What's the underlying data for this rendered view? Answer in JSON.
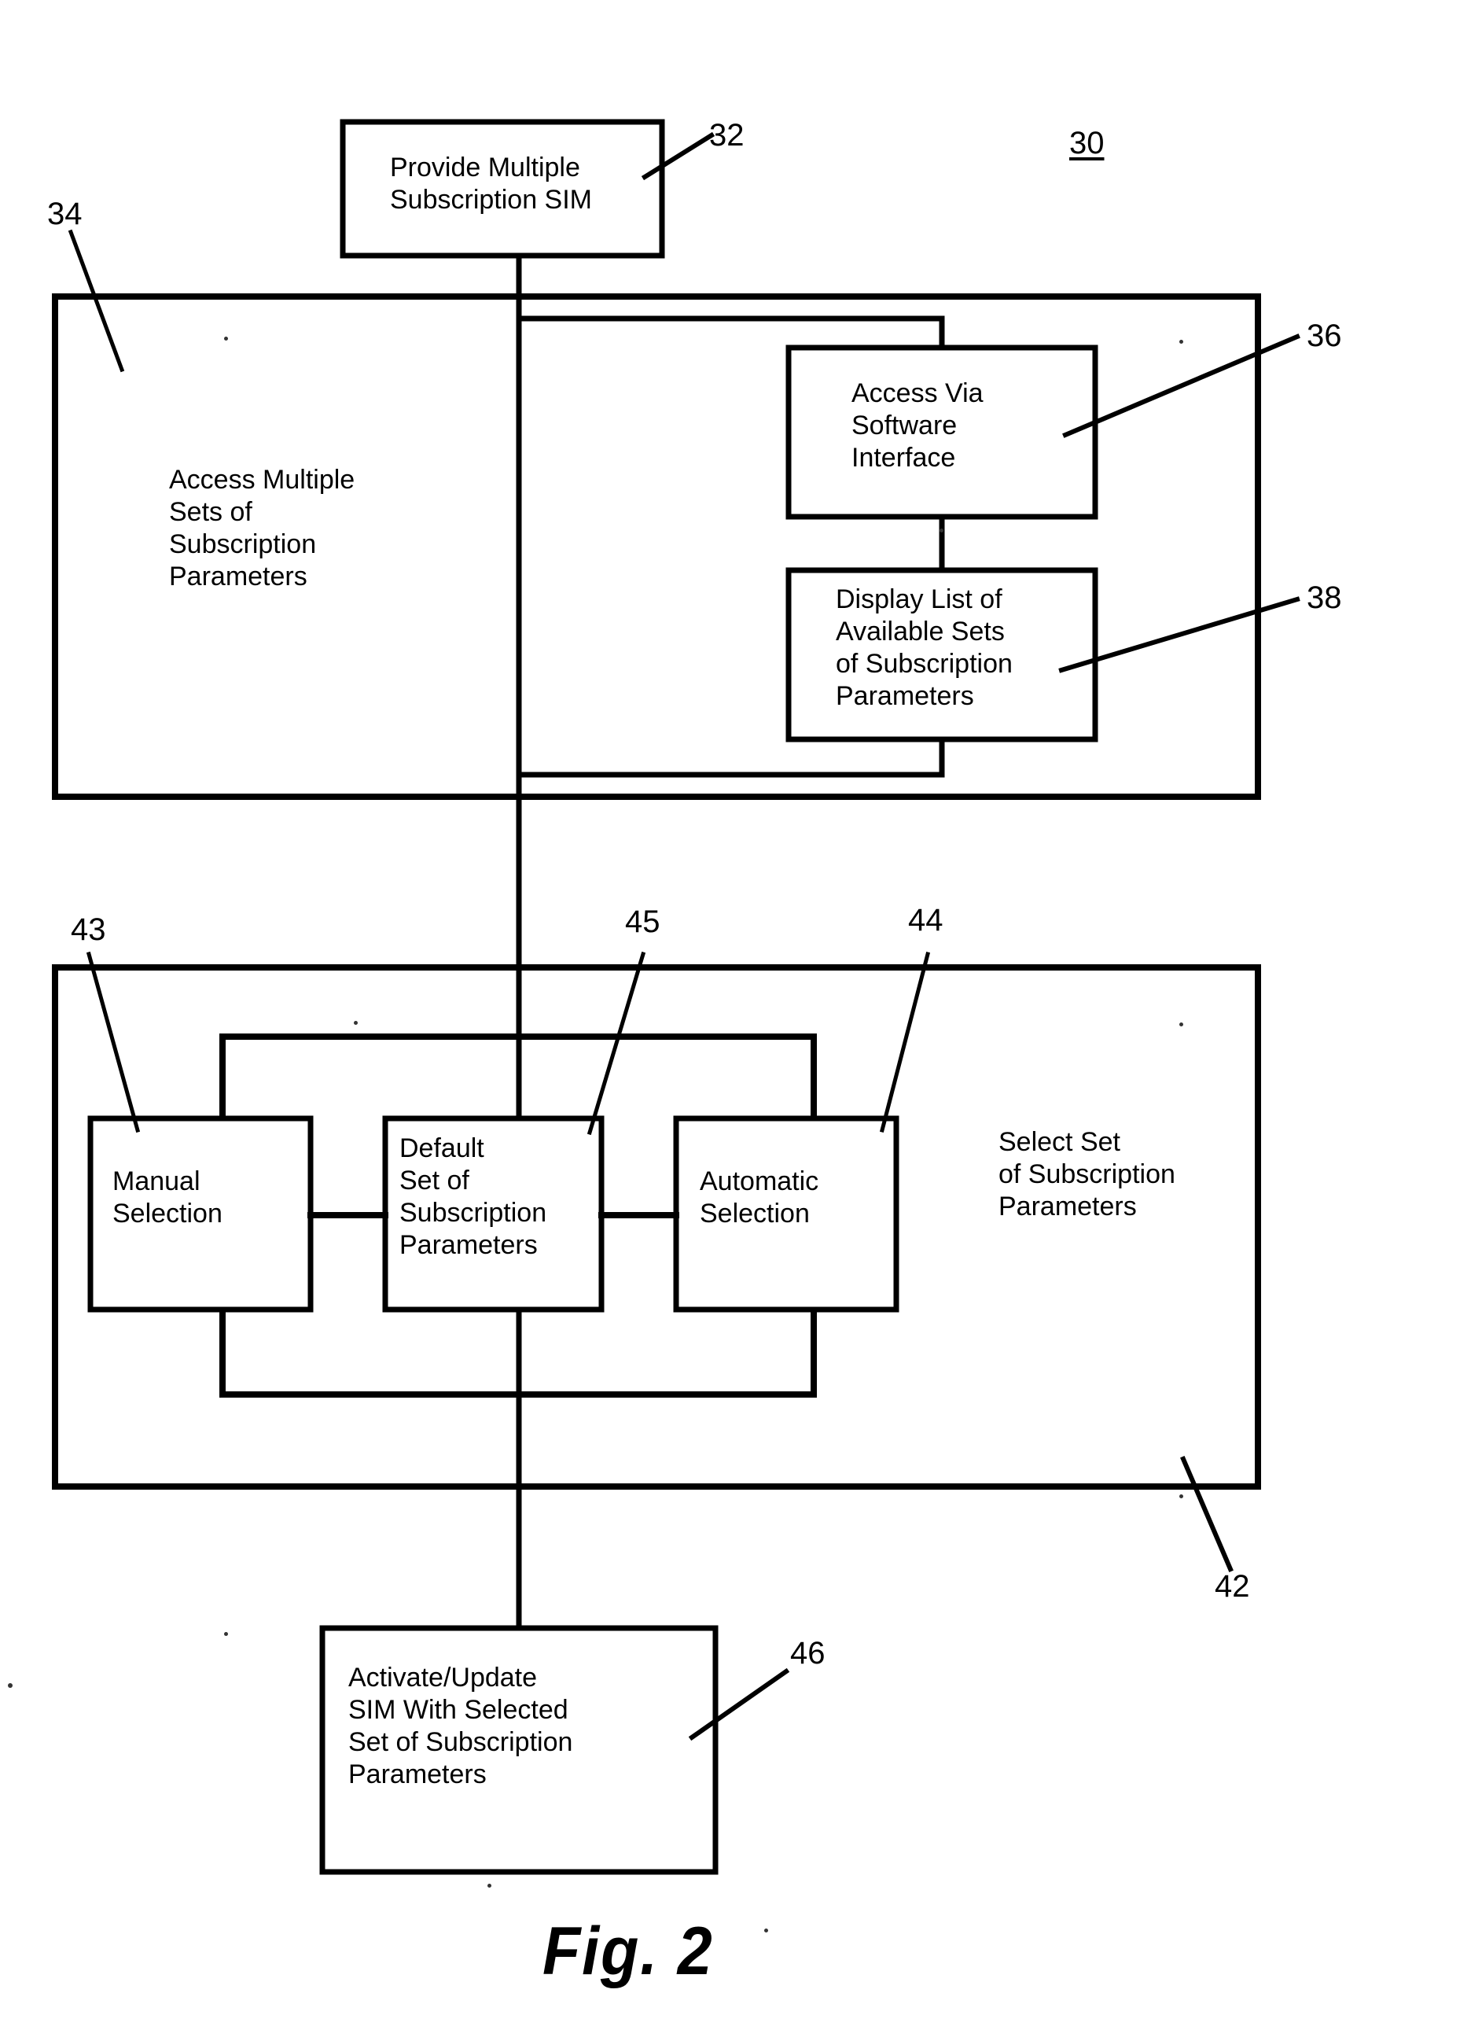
{
  "figure": {
    "caption": "Fig. 2",
    "overall_ref": "30"
  },
  "nodes": [
    {
      "id": "provide",
      "ref": "32",
      "text": "Provide Multiple\nSubscription SIM"
    },
    {
      "id": "access_multiple",
      "ref": "34",
      "text": "Access Multiple\nSets of\nSubscription\nParameters"
    },
    {
      "id": "access_software",
      "ref": "36",
      "text": "Access Via\nSoftware\nInterface"
    },
    {
      "id": "display_list",
      "ref": "38",
      "text": "Display List of\nAvailable Sets\nof Subscription\nParameters"
    },
    {
      "id": "select_set",
      "ref": "42",
      "text": "Select Set\nof Subscription\nParameters"
    },
    {
      "id": "manual",
      "ref": "43",
      "text": "Manual\nSelection"
    },
    {
      "id": "automatic",
      "ref": "44",
      "text": "Automatic\nSelection"
    },
    {
      "id": "default_set",
      "ref": "45",
      "text": "Default\nSet of\nSubscription\nParameters"
    },
    {
      "id": "activate",
      "ref": "46",
      "text": "Activate/Update\nSIM With Selected\nSet of Subscription\nParameters"
    }
  ],
  "colors": {
    "ink": "#000000",
    "paper": "#ffffff"
  }
}
